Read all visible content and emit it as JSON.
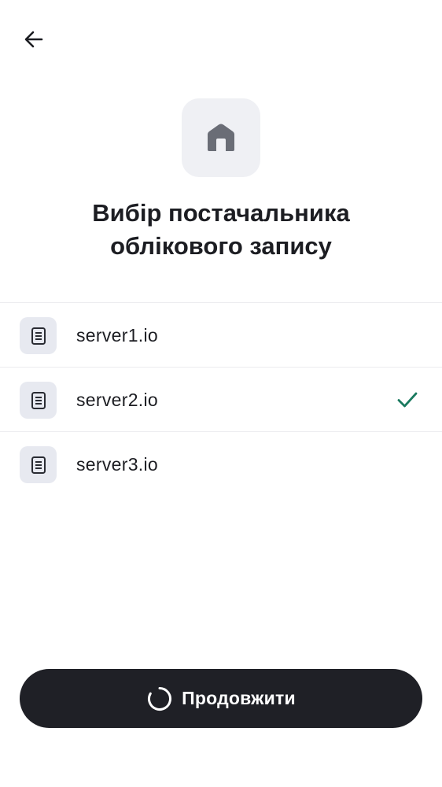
{
  "header": {
    "back_icon": "arrow-left-icon"
  },
  "hero": {
    "icon": "home-icon",
    "title_line1": "Вибір постачальника",
    "title_line2": "облікового запису"
  },
  "providers": [
    {
      "label": "server1.io",
      "icon": "server-icon",
      "selected": false
    },
    {
      "label": "server2.io",
      "icon": "server-icon",
      "selected": true
    },
    {
      "label": "server3.io",
      "icon": "server-icon",
      "selected": false
    }
  ],
  "footer": {
    "continue_label": "Продовжити",
    "loading_icon": "spinner-icon"
  },
  "colors": {
    "accent_check": "#1a7a5f",
    "button_bg": "#1f2026",
    "icon_bg": "#eff0f4",
    "item_icon_bg": "#e7e9f0"
  }
}
